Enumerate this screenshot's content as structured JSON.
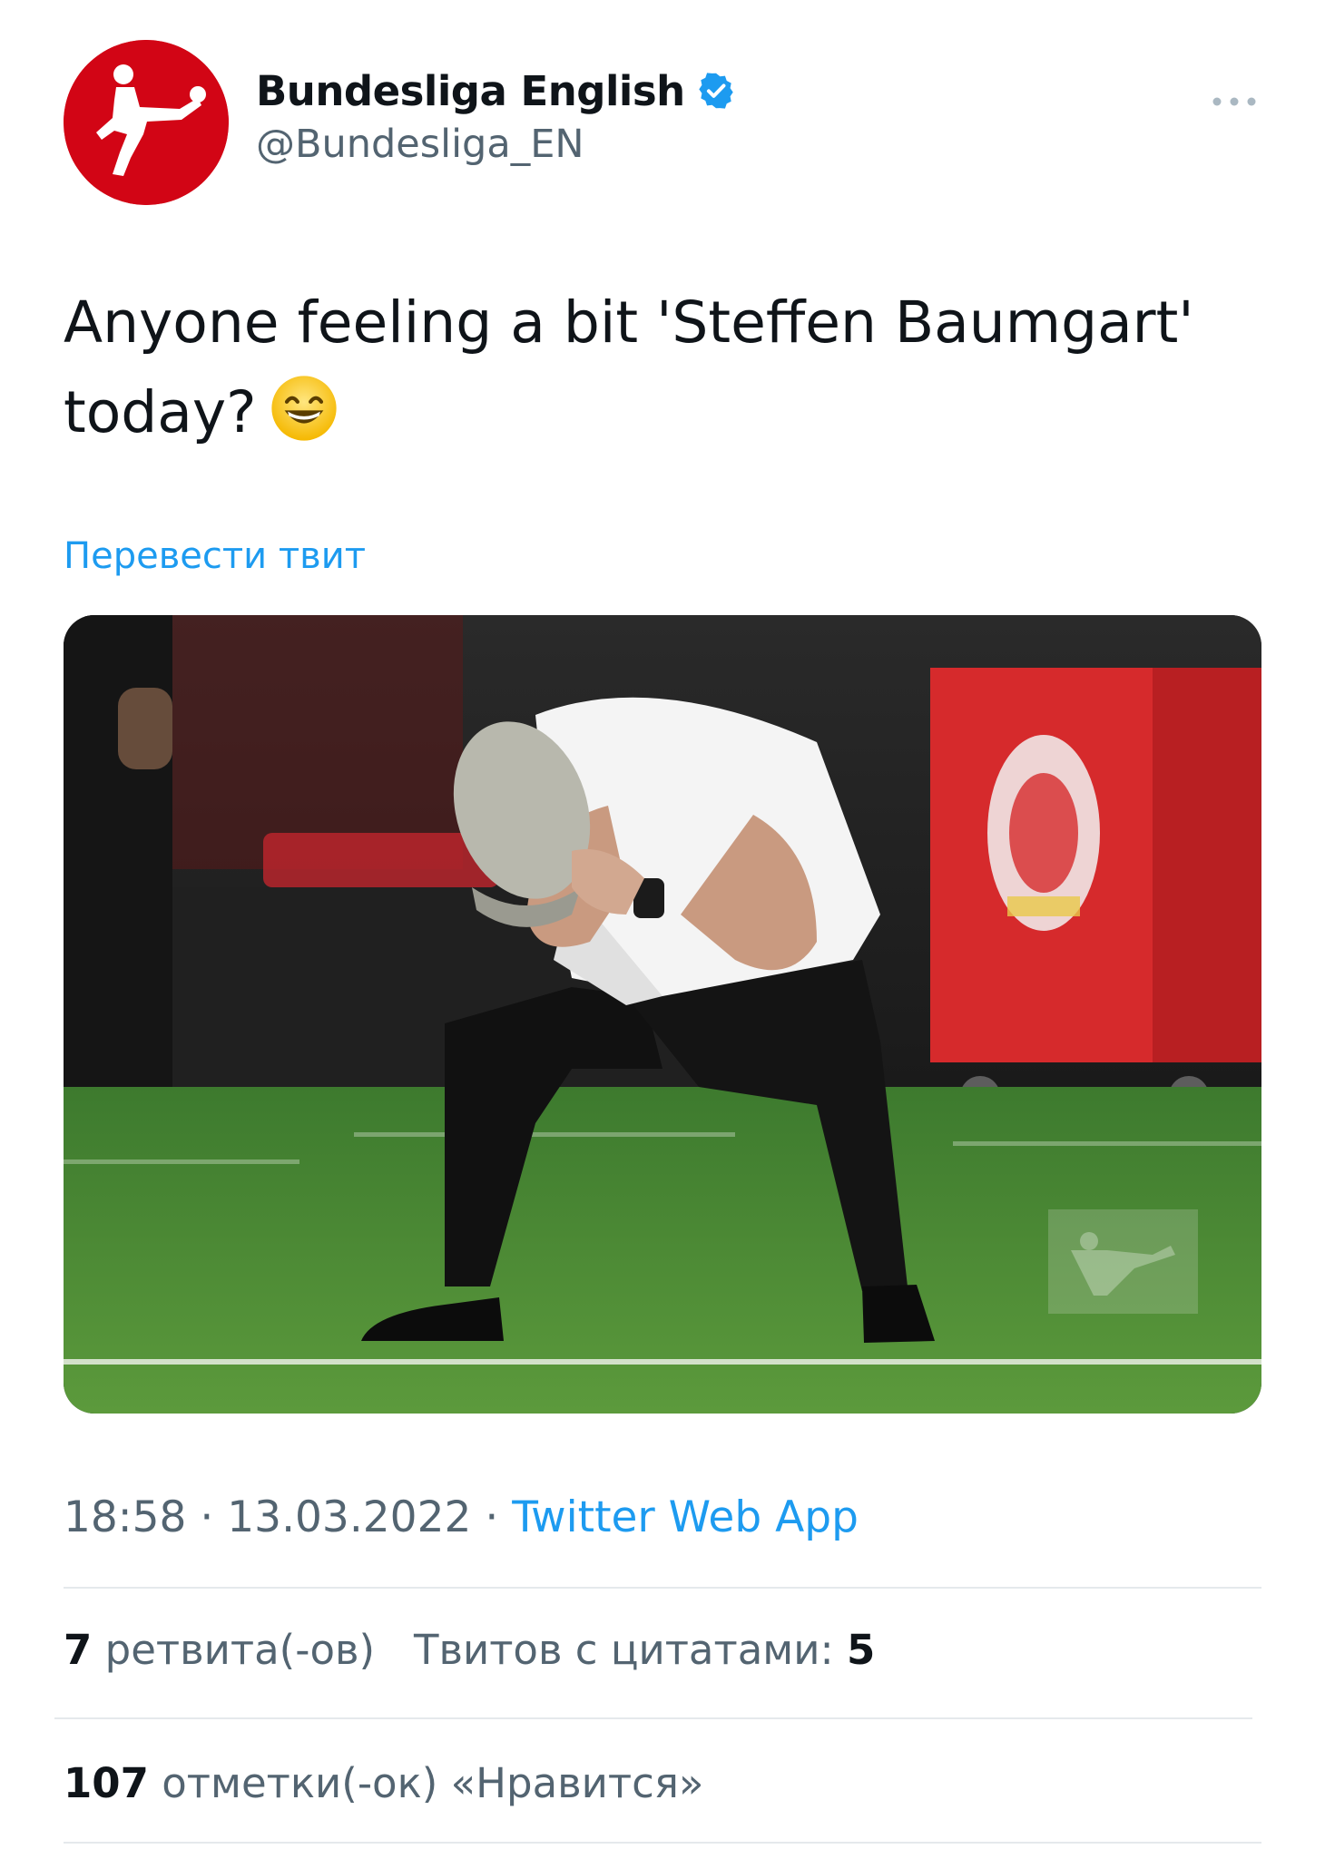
{
  "author": {
    "display_name": "Bundesliga English",
    "handle": "@Bundesliga_EN",
    "verified": true,
    "avatar_icon": "bundesliga-logo-icon",
    "avatar_color": "#d20515"
  },
  "more_icon": "more-dots-icon",
  "tweet": {
    "text_line1": "Anyone feeling a bit 'Steffen Baumgart'",
    "text_line2": "today?",
    "emoji": "grinning-face-with-smiling-eyes-emoji",
    "translate_label": "Перевести твит"
  },
  "media": {
    "type": "photo",
    "watermark_icon": "bundesliga-logo-icon"
  },
  "meta": {
    "time": "18:58",
    "separator1": " · ",
    "date": "13.03.2022",
    "separator2": " · ",
    "source": "Twitter Web App"
  },
  "stats": {
    "retweets_count": "7",
    "retweets_label": "ретвита(-ов)",
    "quotes_label": "Твитов с цитатами:",
    "quotes_count": "5",
    "likes_count": "107",
    "likes_label": "отметки(-ок) «Нравится»"
  },
  "colors": {
    "link": "#1d9bf0",
    "secondary_text": "#536471",
    "primary_text": "#0f1419",
    "verified": "#1d9bf0"
  }
}
